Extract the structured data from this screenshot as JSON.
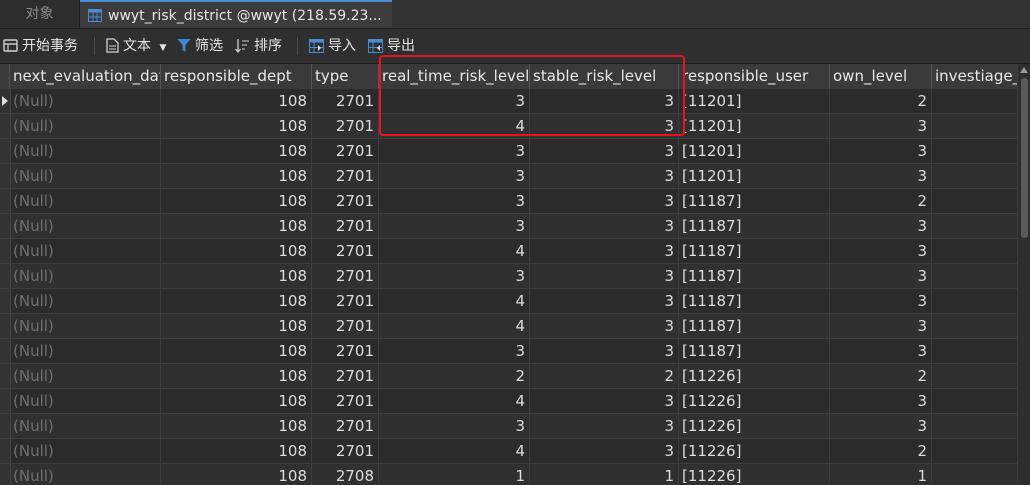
{
  "tabs": {
    "objects_label": "对象",
    "active_label": "wwyt_risk_district @wwyt (218.59.23..."
  },
  "toolbar": {
    "begin_transaction": "开始事务",
    "text": "文本",
    "filter": "筛选",
    "sort": "排序",
    "import": "导入",
    "export": "导出"
  },
  "columns": [
    "next_evaluation_date",
    "responsible_dept",
    "type",
    "real_time_risk_level",
    "stable_risk_level",
    "responsible_user",
    "own_level",
    "investiage_"
  ],
  "null_text": "(Null)",
  "rows": [
    {
      "responsible_dept": "108",
      "type": "2701",
      "real_time_risk_level": "3",
      "stable_risk_level": "3",
      "responsible_user": "[11201]",
      "own_level": "2"
    },
    {
      "responsible_dept": "108",
      "type": "2701",
      "real_time_risk_level": "4",
      "stable_risk_level": "3",
      "responsible_user": "[11201]",
      "own_level": "3"
    },
    {
      "responsible_dept": "108",
      "type": "2701",
      "real_time_risk_level": "3",
      "stable_risk_level": "3",
      "responsible_user": "[11201]",
      "own_level": "3"
    },
    {
      "responsible_dept": "108",
      "type": "2701",
      "real_time_risk_level": "3",
      "stable_risk_level": "3",
      "responsible_user": "[11201]",
      "own_level": "3"
    },
    {
      "responsible_dept": "108",
      "type": "2701",
      "real_time_risk_level": "3",
      "stable_risk_level": "3",
      "responsible_user": "[11187]",
      "own_level": "2"
    },
    {
      "responsible_dept": "108",
      "type": "2701",
      "real_time_risk_level": "3",
      "stable_risk_level": "3",
      "responsible_user": "[11187]",
      "own_level": "3"
    },
    {
      "responsible_dept": "108",
      "type": "2701",
      "real_time_risk_level": "4",
      "stable_risk_level": "3",
      "responsible_user": "[11187]",
      "own_level": "3"
    },
    {
      "responsible_dept": "108",
      "type": "2701",
      "real_time_risk_level": "3",
      "stable_risk_level": "3",
      "responsible_user": "[11187]",
      "own_level": "3"
    },
    {
      "responsible_dept": "108",
      "type": "2701",
      "real_time_risk_level": "4",
      "stable_risk_level": "3",
      "responsible_user": "[11187]",
      "own_level": "3"
    },
    {
      "responsible_dept": "108",
      "type": "2701",
      "real_time_risk_level": "4",
      "stable_risk_level": "3",
      "responsible_user": "[11187]",
      "own_level": "3"
    },
    {
      "responsible_dept": "108",
      "type": "2701",
      "real_time_risk_level": "3",
      "stable_risk_level": "3",
      "responsible_user": "[11187]",
      "own_level": "3"
    },
    {
      "responsible_dept": "108",
      "type": "2701",
      "real_time_risk_level": "2",
      "stable_risk_level": "2",
      "responsible_user": "[11226]",
      "own_level": "2"
    },
    {
      "responsible_dept": "108",
      "type": "2701",
      "real_time_risk_level": "4",
      "stable_risk_level": "3",
      "responsible_user": "[11226]",
      "own_level": "3"
    },
    {
      "responsible_dept": "108",
      "type": "2701",
      "real_time_risk_level": "3",
      "stable_risk_level": "3",
      "responsible_user": "[11226]",
      "own_level": "3"
    },
    {
      "responsible_dept": "108",
      "type": "2701",
      "real_time_risk_level": "4",
      "stable_risk_level": "3",
      "responsible_user": "[11226]",
      "own_level": "2"
    },
    {
      "responsible_dept": "108",
      "type": "2708",
      "real_time_risk_level": "1",
      "stable_risk_level": "1",
      "responsible_user": "[11226]",
      "own_level": "1"
    }
  ],
  "colors": {
    "highlight": "#e8141c",
    "accent": "#4a8bd6"
  }
}
